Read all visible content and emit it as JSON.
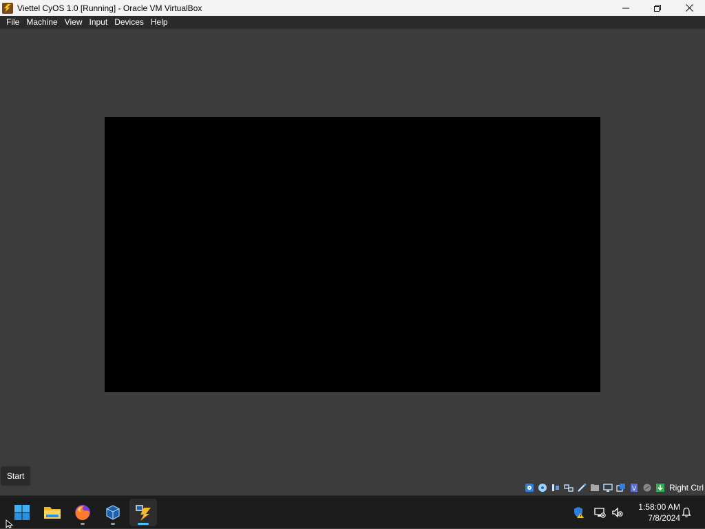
{
  "window": {
    "title": "Viettel CyOS 1.0 [Running] - Oracle VM VirtualBox",
    "icon": "virtualbox-vm-icon"
  },
  "menu": [
    {
      "label": "File"
    },
    {
      "label": "Machine"
    },
    {
      "label": "View"
    },
    {
      "label": "Input"
    },
    {
      "label": "Devices"
    },
    {
      "label": "Help"
    }
  ],
  "vm_screen": {
    "state": "blank",
    "color": "#000000"
  },
  "statusbar": {
    "icons": [
      "hard-disk-icon",
      "optical-drive-icon",
      "audio-icon",
      "network-icon",
      "usb-icon",
      "shared-folders-icon",
      "display-icon",
      "video-capture-icon",
      "virtualization-icon",
      "mouse-integration-icon",
      "keyboard-capture-icon"
    ],
    "host_key": "Right Ctrl"
  },
  "tooltip": {
    "text": "Start"
  },
  "taskbar": {
    "apps": [
      {
        "name": "start-button",
        "icon": "windows-logo-icon"
      },
      {
        "name": "file-explorer",
        "icon": "folder-icon"
      },
      {
        "name": "firefox",
        "icon": "firefox-icon",
        "running": true
      },
      {
        "name": "virtualbox-manager",
        "icon": "virtualbox-cube-icon",
        "running": true
      },
      {
        "name": "virtualbox-vm",
        "icon": "virtualbox-vm-icon",
        "running": true,
        "active": true
      }
    ],
    "tray": {
      "icons": [
        "security-shield-icon",
        "network-disconnected-icon",
        "speaker-muted-icon",
        "notification-bell-icon"
      ],
      "time": "1:58:00 AM",
      "date": "7/8/2024"
    }
  },
  "colors": {
    "titlebar": "#f3f3f3",
    "menubar": "#2b2b2b",
    "workspace": "#3c3c3c",
    "vm_screen": "#000000",
    "taskbar": "#1c1c1c",
    "accent": "#4cc2ff"
  }
}
